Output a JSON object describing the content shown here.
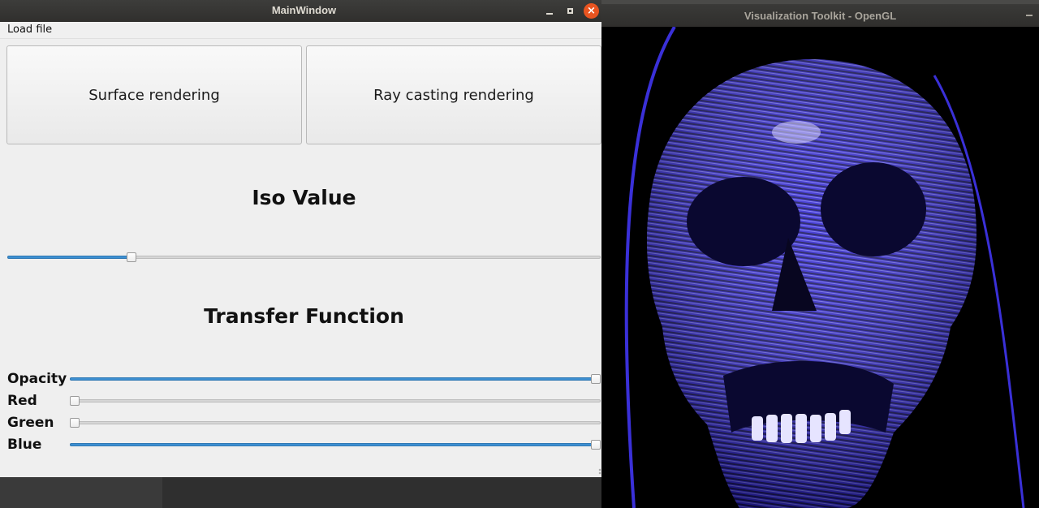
{
  "main_window": {
    "title": "MainWindow",
    "controls": {
      "minimize": "minimize-icon",
      "maximize": "maximize-icon",
      "close": "close-icon",
      "close_glyph": "×"
    },
    "menu": {
      "load_file": "Load file"
    },
    "buttons": {
      "surface": "Surface rendering",
      "raycast": "Ray casting rendering"
    },
    "iso": {
      "heading": "Iso Value",
      "value_fraction": 0.205
    },
    "transfer_function": {
      "heading": "Transfer Function",
      "sliders": [
        {
          "label": "Opacity",
          "value_fraction": 1.0
        },
        {
          "label": "Red",
          "value_fraction": 0.0
        },
        {
          "label": "Green",
          "value_fraction": 0.0
        },
        {
          "label": "Blue",
          "value_fraction": 1.0
        }
      ]
    }
  },
  "vtk_window": {
    "title": "Visualization Toolkit - OpenGL",
    "render": "volume-rendered skull in blue with contour bands"
  },
  "colors": {
    "accent": "#3d8fd1",
    "close_button": "#e95420",
    "titlebar": "#302f2d",
    "render_blue": "#2a1fd0"
  }
}
